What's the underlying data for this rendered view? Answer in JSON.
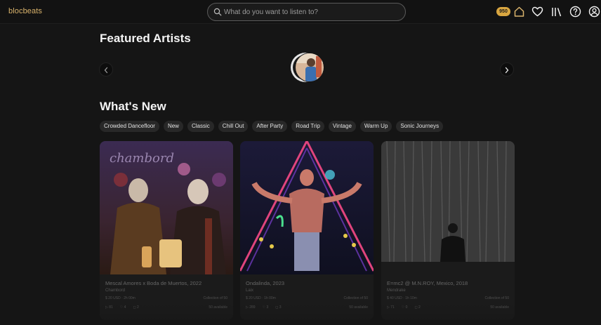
{
  "header": {
    "logo": "blocbeats",
    "search_placeholder": "What do you want to listen to?",
    "coin_balance": "950",
    "icons": [
      "home-icon",
      "heart-icon",
      "library-icon",
      "help-icon",
      "account-icon"
    ]
  },
  "featured": {
    "title": "Featured Artists",
    "artist_count_visible": 2
  },
  "whats_new": {
    "title": "What's New",
    "filters": [
      "Crowded Dancefloor",
      "New",
      "Classic",
      "Chill Out",
      "After Party",
      "Road Trip",
      "Vintage",
      "Warm Up",
      "Sonic Journeys"
    ]
  },
  "cards": [
    {
      "title": "Mescal Amores x Boda de Muertos, 2022",
      "artist": "Chambord",
      "price": "$ 20 USD",
      "duration": "2h 00m",
      "collection": "Collection of 50",
      "plays": "81",
      "likes": "4",
      "comments": "2",
      "availability": "50 available"
    },
    {
      "title": "Ondalinda, 2023",
      "artist": "Laix",
      "price": "$ 20 USD",
      "duration": "1h 00m",
      "collection": "Collection of 50",
      "plays": "289",
      "likes": "3",
      "comments": "3",
      "availability": "50 available"
    },
    {
      "title": "E=mc2 @ M.N.ROY, Mexico, 2018",
      "artist": "Mendrake",
      "price": "$ 40 USD",
      "duration": "1h 10m",
      "collection": "Collection of 50",
      "plays": "71",
      "likes": "0",
      "comments": "2",
      "availability": "50 available"
    }
  ],
  "colors": {
    "background": "#151515",
    "accent_gold": "#d9b36c",
    "coin": "#d9a640",
    "chip": "#282828"
  }
}
